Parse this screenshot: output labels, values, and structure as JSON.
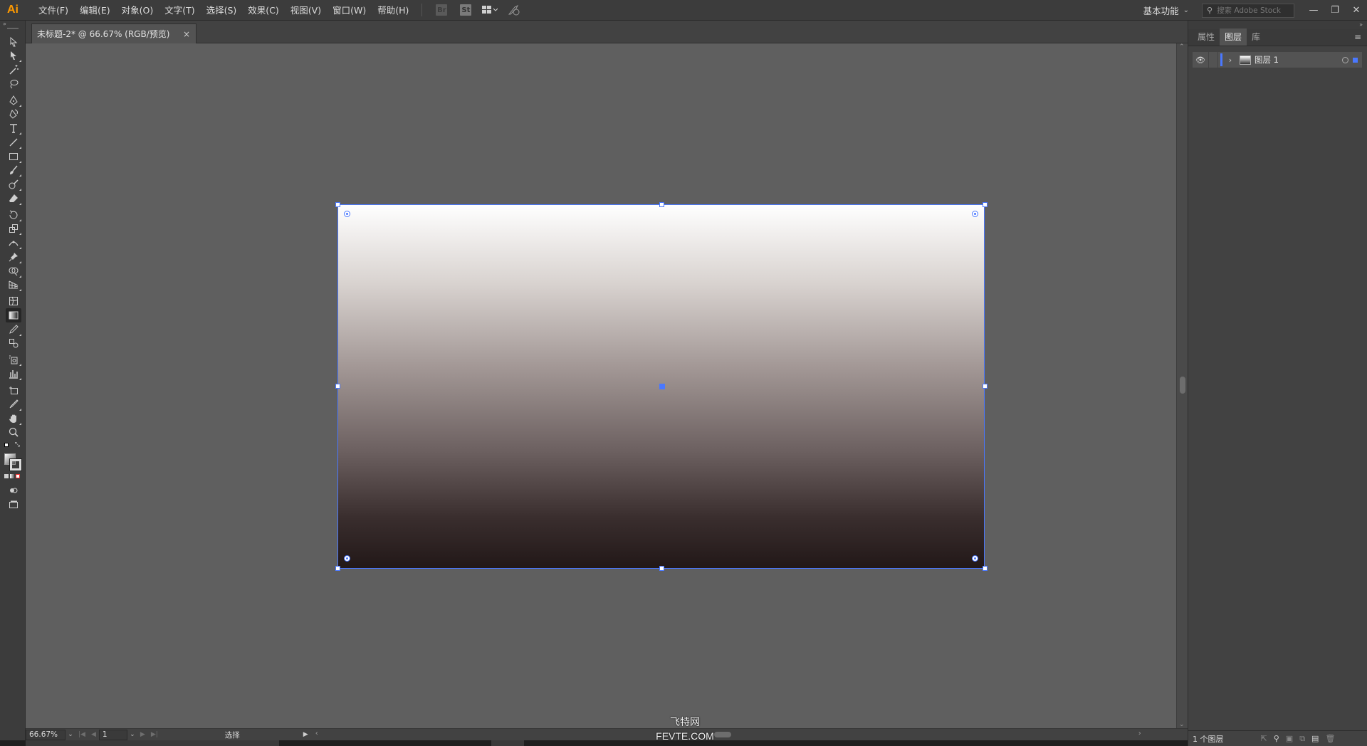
{
  "app": {
    "logo": "Ai",
    "menu": [
      "文件(F)",
      "编辑(E)",
      "对象(O)",
      "文字(T)",
      "选择(S)",
      "效果(C)",
      "视图(V)",
      "窗口(W)",
      "帮助(H)"
    ],
    "toolbar_buttons": {
      "br": "Br",
      "st": "St"
    },
    "workspace": "基本功能",
    "search_placeholder": "搜索 Adobe Stock",
    "accent_color": "#4a78ff",
    "logo_color": "#ff9a00"
  },
  "document": {
    "tab_title": "未标题-2* @ 66.67% (RGB/预览)",
    "close_symbol": "×"
  },
  "tools": [
    "selection-tool",
    "direct-selection-tool",
    "magic-wand-tool",
    "lasso-tool",
    "pen-tool",
    "curvature-tool",
    "type-tool",
    "line-tool",
    "rectangle-tool",
    "paintbrush-tool",
    "shaper-tool",
    "eraser-tool",
    "rotate-tool",
    "scale-tool",
    "width-tool",
    "puppet-warp-tool",
    "shape-builder-tool",
    "perspective-grid-tool",
    "mesh-tool",
    "gradient-tool",
    "eyedropper-tool",
    "blend-tool",
    "symbol-sprayer-tool",
    "column-graph-tool",
    "artboard-tool",
    "slice-tool",
    "hand-tool",
    "zoom-tool"
  ],
  "artboard": {
    "gradient_colors": [
      "#ffffff",
      "#221818"
    ]
  },
  "status": {
    "zoom": "66.67%",
    "page": "1",
    "mode": "选择"
  },
  "panel": {
    "tabs": [
      "属性",
      "图层",
      "库"
    ],
    "active_tab": "图层",
    "layer_name": "图层 1",
    "footer_count": "1 个图层"
  },
  "watermark": {
    "line1": "飞特网",
    "line2": "FEVTE.COM"
  }
}
